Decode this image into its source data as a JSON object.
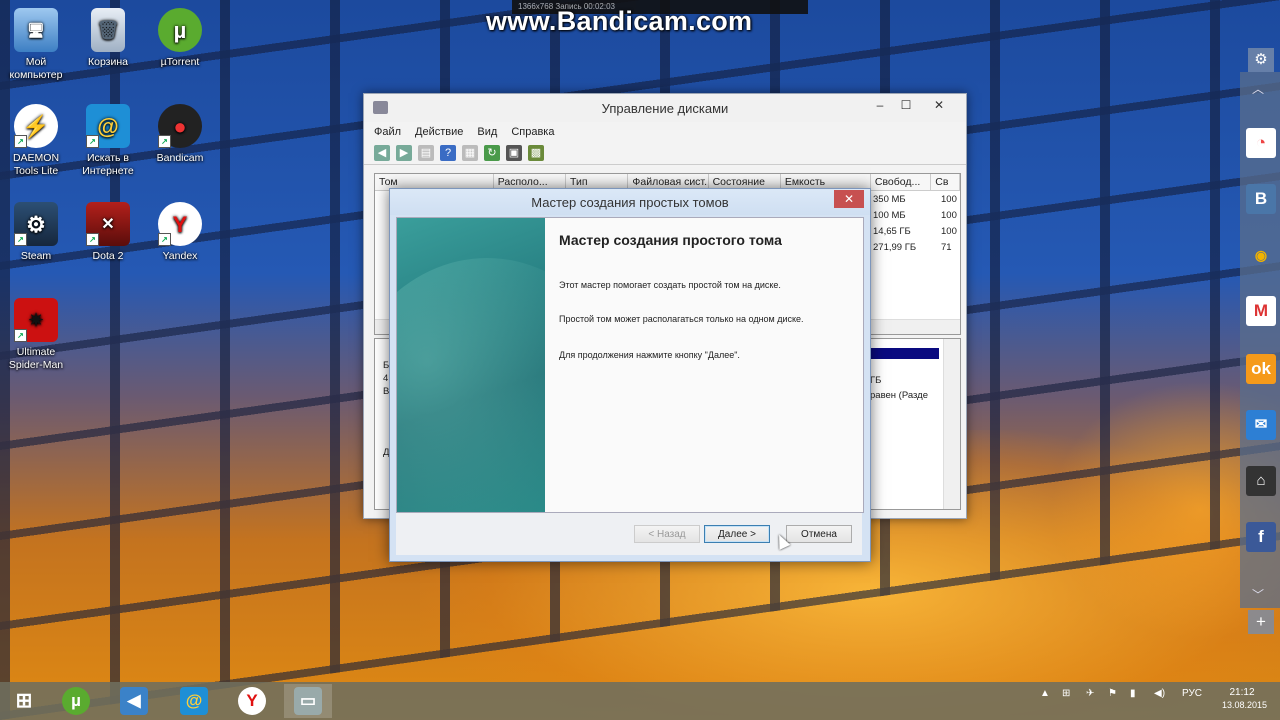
{
  "watermark": {
    "text": "www.Bandicam.com",
    "bar_text": "1366x768   Запись   00:02:03"
  },
  "desktop_icons": [
    {
      "label": "Мой\nкомпьютер"
    },
    {
      "label": "Корзина"
    },
    {
      "label": "µTorrent"
    },
    {
      "label": "DAEMON\nTools Lite"
    },
    {
      "label": "Искать в\nИнтернете"
    },
    {
      "label": "Bandicam"
    },
    {
      "label": "Steam"
    },
    {
      "label": "Dota 2"
    },
    {
      "label": "Yandex"
    },
    {
      "label": "Ultimate\nSpider-Man"
    }
  ],
  "disk_management": {
    "title": "Управление дисками",
    "menu": [
      "Файл",
      "Действие",
      "Вид",
      "Справка"
    ],
    "columns": [
      "Том",
      "Располо...",
      "Тип",
      "Файловая сист...",
      "Состояние",
      "Емкость",
      "Свобод...",
      "Св"
    ],
    "rows": [
      {
        "free": "350 МБ",
        "pct": "100"
      },
      {
        "free": "100 МБ",
        "pct": "100"
      },
      {
        "free": "14,65 ГБ",
        "pct": "100"
      },
      {
        "free": "271,99 ГБ",
        "pct": "71"
      }
    ],
    "lower_text": [
      "ГБ",
      "равен (Разде"
    ],
    "lower_left_letters": [
      "Д",
      "Б",
      "4",
      "В"
    ]
  },
  "wizard": {
    "title": "Мастер создания простых томов",
    "heading": "Мастер создания простого тома",
    "p1": "Этот мастер помогает создать простой том на диске.",
    "p2": "Простой том может располагаться только на одном диске.",
    "p3": "Для продолжения нажмите кнопку \"Далее\".",
    "buttons": {
      "back": "< Назад",
      "next": "Далее >",
      "cancel": "Отмена"
    }
  },
  "taskbar": {
    "language": "РУС",
    "time": "21:12",
    "date": "13.08.2015"
  },
  "colors": {
    "accent_sidebar": "#5a6e8c",
    "wizard_teal": "#2a8486",
    "close_red": "#c75050"
  }
}
